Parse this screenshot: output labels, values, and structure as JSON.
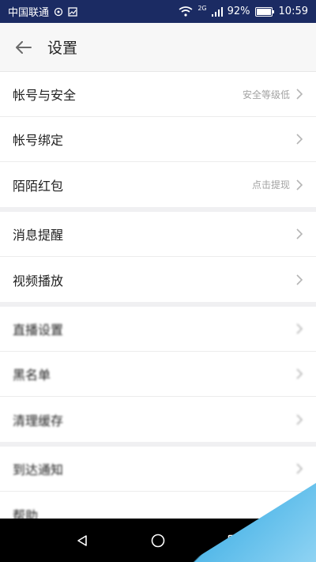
{
  "status_bar": {
    "carrier": "中国联通",
    "network": "2G",
    "battery": "92%",
    "time": "10:59"
  },
  "header": {
    "title": "设置"
  },
  "groups": [
    {
      "rows": [
        {
          "label": "帐号与安全",
          "value": "安全等级低"
        },
        {
          "label": "帐号绑定",
          "value": ""
        },
        {
          "label": "陌陌红包",
          "value": "点击提现"
        }
      ]
    },
    {
      "rows": [
        {
          "label": "消息提醒",
          "value": ""
        },
        {
          "label": "视频播放",
          "value": ""
        }
      ]
    },
    {
      "rows": [
        {
          "label": "直播设置",
          "value": ""
        },
        {
          "label": "黑名单",
          "value": ""
        },
        {
          "label": "清理缓存",
          "value": ""
        }
      ]
    },
    {
      "rows": [
        {
          "label": "到达通知",
          "value": ""
        },
        {
          "label": "帮助",
          "value": ""
        }
      ]
    }
  ],
  "icons": {
    "back": "arrow-left-icon",
    "chevron": "chevron-right-icon",
    "nav_back": "triangle-back-icon",
    "nav_home": "circle-home-icon",
    "nav_recents": "square-recents-icon"
  },
  "colors": {
    "status_bar": "#1b2b63",
    "watermark": "#55b9e9"
  }
}
